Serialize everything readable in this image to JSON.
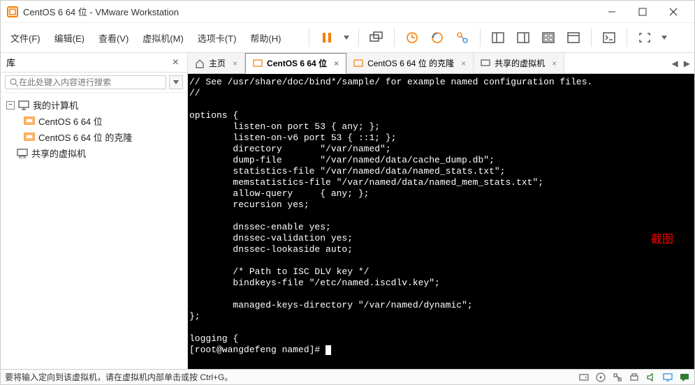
{
  "window": {
    "title": "CentOS 6 64 位 - VMware Workstation"
  },
  "menu": {
    "file": "文件(F)",
    "edit": "编辑(E)",
    "view": "查看(V)",
    "vm": "虚拟机(M)",
    "tabs": "选项卡(T)",
    "help": "帮助(H)"
  },
  "sidebar": {
    "title": "库",
    "search_placeholder": "在此处键入内容进行搜索",
    "root": "我的计算机",
    "items": [
      "CentOS 6 64 位",
      "CentOS 6 64 位 的克隆",
      "共享的虚拟机"
    ]
  },
  "tabs": {
    "t0": {
      "label": "主页"
    },
    "t1": {
      "label": "CentOS 6 64 位"
    },
    "t2": {
      "label": "CentOS 6 64 位 的克隆"
    },
    "t3": {
      "label": "共享的虚拟机"
    }
  },
  "terminal": {
    "lines": "// See /usr/share/doc/bind*/sample/ for example named configuration files.\n//\n\noptions {\n        listen-on port 53 { any; };\n        listen-on-v6 port 53 { ::1; };\n        directory       \"/var/named\";\n        dump-file       \"/var/named/data/cache_dump.db\";\n        statistics-file \"/var/named/data/named_stats.txt\";\n        memstatistics-file \"/var/named/data/named_mem_stats.txt\";\n        allow-query     { any; };\n        recursion yes;\n\n        dnssec-enable yes;\n        dnssec-validation yes;\n        dnssec-lookaside auto;\n\n        /* Path to ISC DLV key */\n        bindkeys-file \"/etc/named.iscdlv.key\";\n\n        managed-keys-directory \"/var/named/dynamic\";\n};\n\nlogging {\n[root@wangdefeng named]# ",
    "annotation": "截图"
  },
  "status": {
    "text": "要将输入定向到该虚拟机，请在虚拟机内部单击或按 Ctrl+G。"
  }
}
